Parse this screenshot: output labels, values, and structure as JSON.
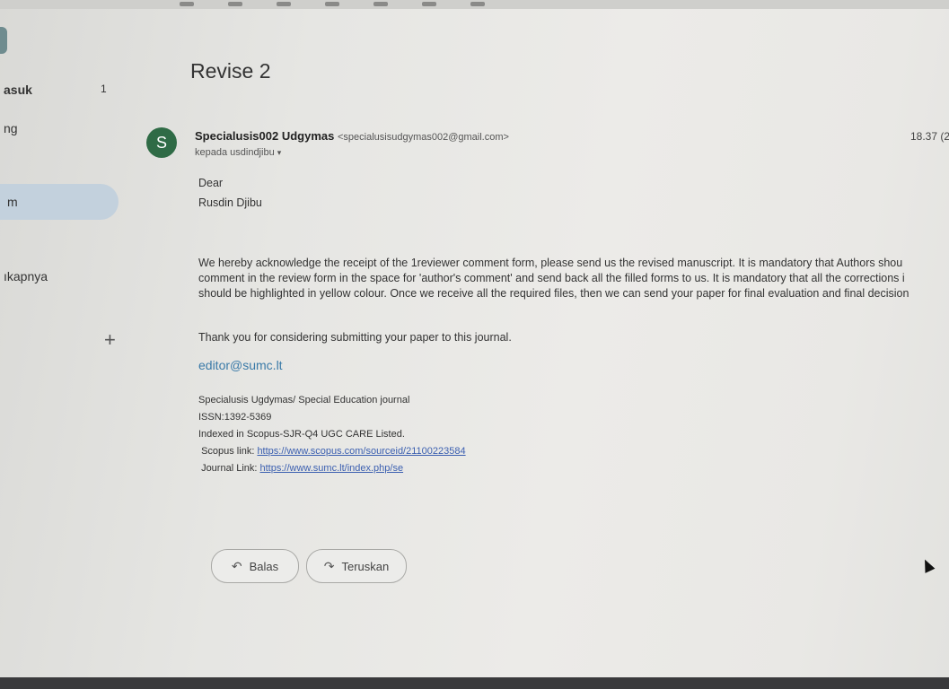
{
  "sidebar": {
    "inbox_label": "asuk",
    "inbox_count": "1",
    "starred_label": "ng",
    "active_label": "m",
    "more_label": "ıkapnya",
    "add_symbol": "+"
  },
  "email": {
    "subject": "Revise 2",
    "avatar_letter": "S",
    "sender_name": "Specialusis002 Udgymas",
    "sender_email": "<specialusisudgymas002@gmail.com>",
    "recipient": "kepada usdindjibu",
    "recipient_caret": "▾",
    "time": "18.37 (2",
    "greeting_line1": "Dear",
    "greeting_line2": "Rusdin Djibu",
    "paragraph_lines": [
      "We hereby acknowledge the receipt of the 1reviewer comment form, please send us the revised manuscript. It is mandatory that Authors shou",
      "comment in the review form in the space for 'author's comment' and send back all the filled forms to us. It is mandatory that all the corrections i",
      "should be highlighted in yellow colour. Once we receive all the required files, then we can send your paper for final evaluation and final decision"
    ],
    "thanks": "Thank you for considering submitting your paper to this journal.",
    "editor_email": "editor@sumc.lt",
    "signature": {
      "journal": "Specialusis Ugdymas/ Special Education journal",
      "issn": "ISSN:1392-5369",
      "indexed": "Indexed in Scopus-SJR-Q4 UGC CARE Listed.",
      "scopus_label": "Scopus link: ",
      "scopus_url": "https://www.scopus.com/sourceid/21100223584",
      "journal_label": "Journal Link: ",
      "journal_url": "https://www.sumc.lt/index.php/se"
    }
  },
  "actions": {
    "reply_label": "Balas",
    "forward_label": "Teruskan"
  }
}
